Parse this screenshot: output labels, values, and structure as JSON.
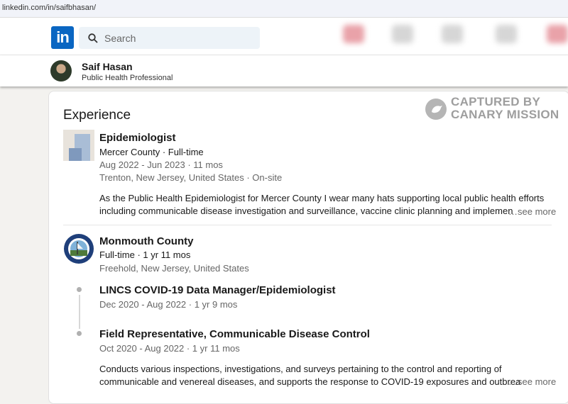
{
  "browser": {
    "url": "linkedin.com/in/saifbhasan/"
  },
  "nav": {
    "logo": "in",
    "search_placeholder": "Search"
  },
  "profile": {
    "name": "Saif Hasan",
    "headline": "Public Health Professional"
  },
  "watermark": {
    "line1": "CAPTURED BY",
    "line2": "CANARY MISSION"
  },
  "experience": {
    "title": "Experience",
    "job1": {
      "title": "Epidemiologist",
      "company": "Mercer County · Full-time",
      "dates": "Aug 2022 - Jun 2023 · 11 mos",
      "location": "Trenton, New Jersey, United States · On-site",
      "desc_line1": "As the Public Health Epidemiologist for Mercer County I wear many hats supporting local public health efforts",
      "desc_line2": "including communicable disease investigation and surveillance, vaccine clinic planning and implemen",
      "see_more": "…see more"
    },
    "job2": {
      "company": "Monmouth County",
      "duration": "Full-time · 1 yr 11 mos",
      "location": "Freehold, New Jersey, United States",
      "role1": {
        "title": "LINCS COVID-19 Data Manager/Epidemiologist",
        "dates": "Dec 2020 - Aug 2022 · 1 yr 9 mos"
      },
      "role2": {
        "title": "Field Representative, Communicable Disease Control",
        "dates": "Oct 2020 - Aug 2022 · 1 yr 11 mos",
        "desc_line1": "Conducts various inspections, investigations, and surveys pertaining to the control and reporting of",
        "desc_line2": "communicable and venereal diseases, and supports the response to COVID-19 exposures and outbrea",
        "see_more": "…see more"
      }
    }
  }
}
